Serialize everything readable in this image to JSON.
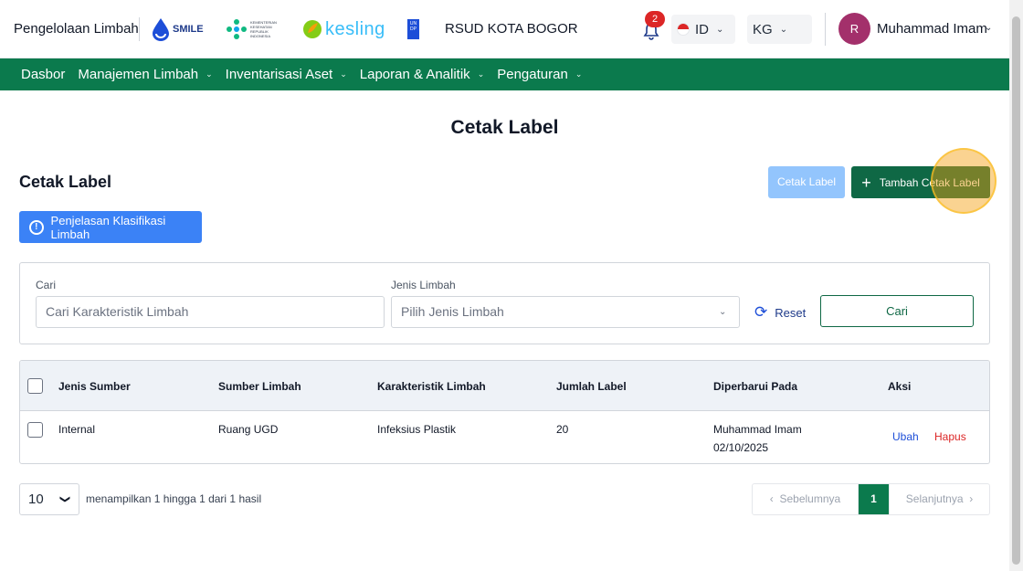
{
  "header": {
    "app_name": "Pengelolaan Limbah",
    "logos": {
      "smile": "SMILE",
      "kemenkes": "KEMENTERIAN KESEHATAN REPUBLIK INDONESIA",
      "kesling": "kesling",
      "undp": "UN DP"
    },
    "hospital": "RSUD KOTA BOGOR",
    "notification_count": "2",
    "language": "ID",
    "unit": "KG",
    "avatar_initial": "R",
    "user_name": "Muhammad Imam"
  },
  "nav": {
    "items": [
      {
        "label": "Dasbor"
      },
      {
        "label": "Manajemen Limbah"
      },
      {
        "label": "Inventarisasi Aset"
      },
      {
        "label": "Laporan & Analitik"
      },
      {
        "label": "Pengaturan"
      }
    ]
  },
  "page": {
    "title": "Cetak Label",
    "section_title": "Cetak Label",
    "print_button": "Cetak Label",
    "add_button": "Tambah Cetak Label",
    "info_button": "Penjelasan Klasifikasi Limbah"
  },
  "filter": {
    "search_label": "Cari",
    "search_placeholder": "Cari Karakteristik Limbah",
    "type_label": "Jenis Limbah",
    "type_placeholder": "Pilih Jenis Limbah",
    "reset_label": "Reset",
    "search_button": "Cari"
  },
  "table": {
    "headers": [
      "Jenis Sumber",
      "Sumber Limbah",
      "Karakteristik Limbah",
      "Jumlah Label",
      "Diperbarui Pada",
      "Aksi"
    ],
    "rows": [
      {
        "source_type": "Internal",
        "source": "Ruang UGD",
        "characteristic": "Infeksius Plastik",
        "label_count": "20",
        "updated_by": "Muhammad Imam",
        "updated_date": "02/10/2025",
        "edit": "Ubah",
        "delete": "Hapus"
      }
    ]
  },
  "footer": {
    "per_page": "10",
    "showing": "menampilkan 1 hingga 1 dari 1 hasil",
    "prev": "Sebelumnya",
    "current_page": "1",
    "next": "Selanjutnya"
  },
  "colors": {
    "primary_green": "#0b7a4d",
    "button_green": "#0f6845",
    "info_blue": "#3b82f6",
    "disabled_blue": "#93c5fd",
    "danger_red": "#dc2626"
  }
}
